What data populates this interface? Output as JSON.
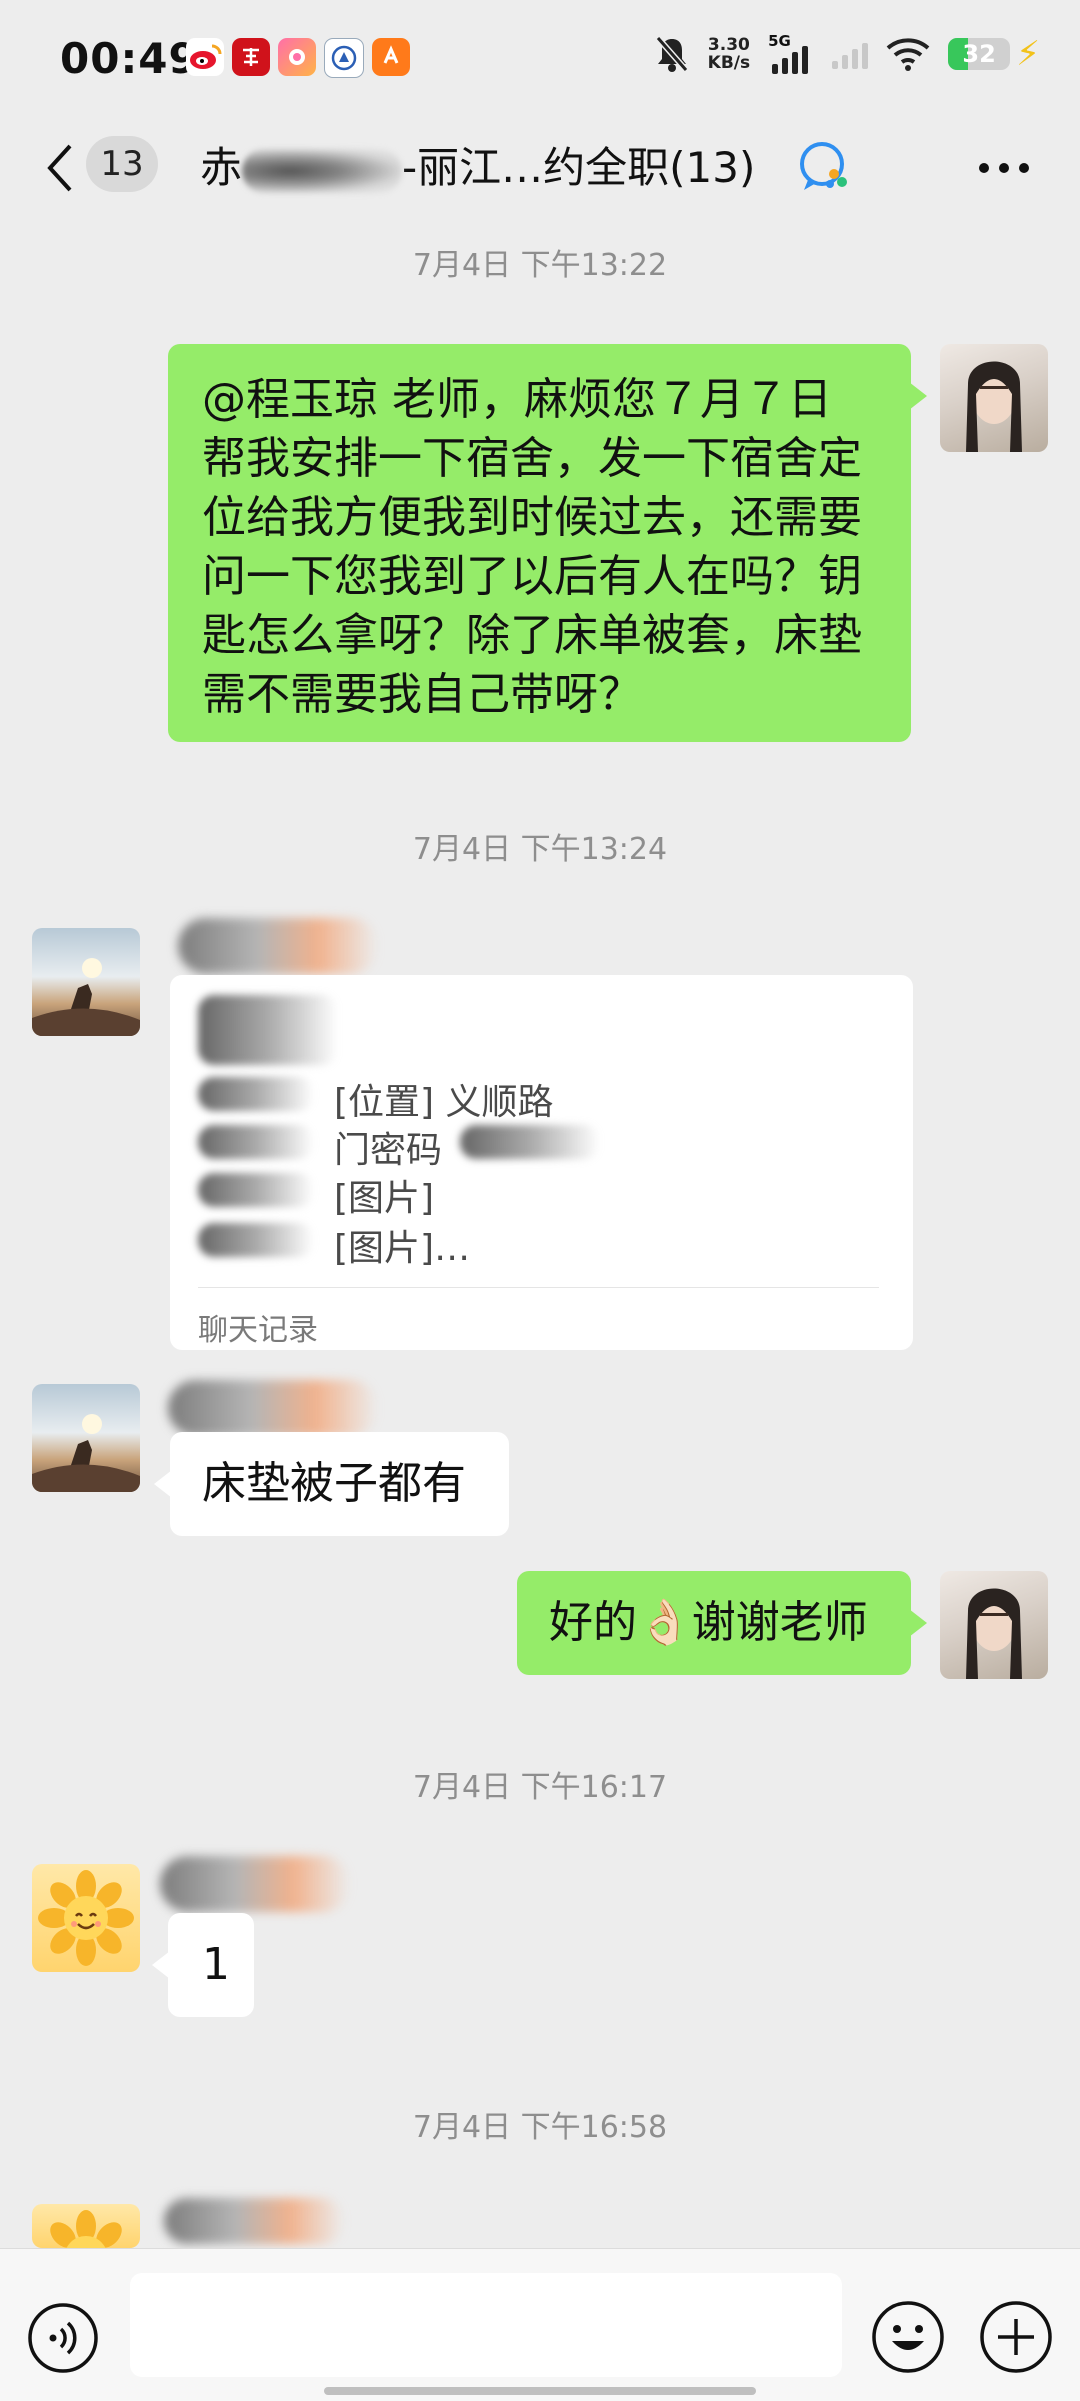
{
  "status_bar": {
    "time": "00:49",
    "net_speed_value": "3.30",
    "net_speed_unit": "KB/s",
    "network_type": "5G",
    "battery_level": "32",
    "icons": [
      "weibo-icon",
      "app-red-icon",
      "app-pink-icon",
      "app-blue-icon",
      "app-orange-icon",
      "mute-icon",
      "signal-icon",
      "wifi-icon",
      "battery-icon",
      "charging-icon"
    ]
  },
  "header": {
    "back_count": "13",
    "title_prefix": "赤",
    "title_suffix": "-丽江…约全职(13)"
  },
  "messages": [
    {
      "kind": "timestamp",
      "text": "7月4日 下午13:22"
    },
    {
      "kind": "text",
      "side": "right",
      "text": "@程玉琼  老师，麻烦您７月７日\n帮我安排一下宿舍，发一下宿舍定\n位给我方便我到时候过去，还需要\n问一下您我到了以后有人在吗？钥\n匙怎么拿呀？除了床单被套，床垫\n需不需要我自己带呀？"
    },
    {
      "kind": "timestamp",
      "text": "7月4日 下午13:24"
    },
    {
      "kind": "chat_record",
      "side": "left",
      "lines": [
        "[位置] 义顺路",
        "门密码",
        "[图片]",
        "[图片]…"
      ],
      "footer": "聊天记录"
    },
    {
      "kind": "text",
      "side": "left",
      "text": "床垫被子都有"
    },
    {
      "kind": "text",
      "side": "right",
      "text": "好的👌🏻谢谢老师"
    },
    {
      "kind": "timestamp",
      "text": "7月4日 下午16:17"
    },
    {
      "kind": "text",
      "side": "left",
      "text": "1"
    },
    {
      "kind": "timestamp",
      "text": "7月4日 下午16:58"
    }
  ],
  "colors": {
    "background": "#ededed",
    "my_bubble": "#95ec69",
    "other_bubble": "#ffffff",
    "timestamp": "#8e8e8e"
  },
  "input_bar": {
    "icons": [
      "voice-icon",
      "emoji-icon",
      "plus-icon"
    ]
  }
}
